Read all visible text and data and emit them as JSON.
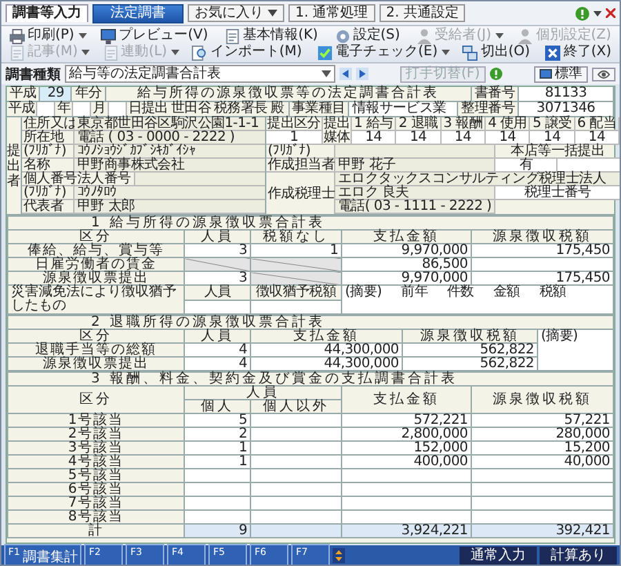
{
  "tabs": [
    {
      "label": "調書等入力",
      "selected": true
    }
  ],
  "mode_button": "法定調書",
  "menus": [
    {
      "label": "お気に入り",
      "dropdown": true
    },
    {
      "label": "1. 通常処理",
      "dropdown": false
    },
    {
      "label": "2. 共通設定",
      "dropdown": false
    }
  ],
  "toolbar": [
    {
      "label": "印刷(P)",
      "disabled": false,
      "dropdown": true
    },
    {
      "label": "プレビュー(V)",
      "disabled": false,
      "dropdown": false
    },
    {
      "label": "基本情報(K)",
      "disabled": false,
      "dropdown": false
    },
    {
      "label": "設定(S)",
      "disabled": false,
      "dropdown": false
    },
    {
      "label": "受給者(J)",
      "disabled": true,
      "dropdown": true
    },
    {
      "label": "個別設定(Z)",
      "disabled": true,
      "dropdown": false
    },
    {
      "label": "記事(M)",
      "disabled": true,
      "dropdown": true
    },
    {
      "label": "連動(L)",
      "disabled": true,
      "dropdown": true
    },
    {
      "label": "インポート(M)",
      "disabled": false,
      "dropdown": false
    },
    {
      "label": "電子チェック(E)",
      "disabled": false,
      "dropdown": true
    },
    {
      "label": "切出(O)",
      "disabled": false,
      "dropdown": false
    },
    {
      "label": "終了(X)",
      "disabled": false,
      "dropdown": false
    }
  ],
  "doc_type": {
    "label": "調書種類",
    "value": "給与等の法定調書合計表"
  },
  "switch_button": {
    "label": "打手切替(F)",
    "disabled": true
  },
  "view_button": "標準",
  "form": {
    "era": "平成",
    "year": "29",
    "year_suffix": "年分",
    "title": "給与所得の源泉徴収票等の法定調書合計表",
    "doc_number_label": "書番号",
    "doc_number": "81133",
    "submission": {
      "era": "平成",
      "units": [
        "年",
        "月",
        "日提出"
      ],
      "office": "世田谷",
      "office_suffix": "税務署長",
      "honorific": "殿"
    },
    "business_label": "事業種目",
    "business": "情報サービス業",
    "ref_label": "整理番号",
    "ref": "3071346",
    "submitter_label": "提出者",
    "left_rows": [
      {
        "labels": [
          "住所又は"
        ],
        "value": "東京都世田谷区駒沢公園1-1-1"
      },
      {
        "labels": [
          "所在地"
        ],
        "value": "電話 ( 03 - 0000 - 2222 )"
      },
      {
        "labels": [
          "(ﾌﾘｶﾞﾅ)"
        ],
        "value": "ｺｳﾉｼｮｳｼﾞｶﾌﾞｼｷｶﾞｲｼｬ"
      },
      {
        "labels": [
          "名称"
        ],
        "value": "甲野商事株式会社"
      },
      {
        "labels": [
          "個人番号",
          "法人番号"
        ]
      },
      {
        "labels": [
          "(ﾌﾘｶﾞﾅ)"
        ],
        "value": "ｺｳﾉﾀﾛｳ"
      },
      {
        "labels": [
          "代表者"
        ],
        "value": "甲野 太郎"
      }
    ],
    "filing": {
      "class_label": "提出区分",
      "class": "1",
      "media_label": "提出媒体",
      "media": [
        {
          "label": "1 給与",
          "value": "14"
        },
        {
          "label": "2 退職",
          "value": "14"
        },
        {
          "label": "3 報酬",
          "value": "14"
        },
        {
          "label": "4 使用",
          "value": "14"
        },
        {
          "label": "5 譲受",
          "value": "14"
        },
        {
          "label": "6 配当",
          "value": "14"
        }
      ]
    },
    "kana_label": "(ﾌﾘｶﾞﾅ)",
    "head_office_label": "本店等一括提出",
    "head_office": "有",
    "contact_label": "作成担当者",
    "contact": "甲野 花子",
    "accountant_label": "作成税理士",
    "accountant_firm": "エロクタックスコンサルティング税理士法人",
    "accountant": "エロク 良夫",
    "accountant_no_label": "税理士番号",
    "accountant_phone": "電話( 03 - 1111 - 2222 )",
    "sec1": {
      "number": "1",
      "title": "給与所得の源泉徴収票合計表",
      "label_column": "区分",
      "columns": [
        "人員",
        "税額なし",
        "支払金額",
        "源泉徴収税額"
      ],
      "rows": [
        {
          "label": "俸給、給与、賞与等",
          "cells": [
            {
              "kind": "value",
              "text": "3"
            },
            {
              "kind": "value",
              "text": "1"
            },
            {
              "kind": "value",
              "text": "9,970,000"
            },
            {
              "kind": "value",
              "text": "175,450"
            }
          ]
        },
        {
          "label": "日雇労働者の賃金",
          "cells": [
            {
              "kind": "na"
            },
            {
              "kind": "na"
            },
            {
              "kind": "value",
              "text": "86,500"
            },
            {
              "kind": "value"
            }
          ]
        },
        {
          "label": "源泉徴収票提出",
          "cells": [
            {
              "kind": "value",
              "text": "3"
            },
            {
              "kind": "na"
            },
            {
              "kind": "value",
              "text": "9,970,000"
            },
            {
              "kind": "value",
              "text": "175,450"
            }
          ]
        }
      ],
      "relief": {
        "label": "災害減免法により徴収猶予したもの",
        "columns": [
          "人員",
          "徴収猶予税額"
        ],
        "notes": [
          "(摘要)",
          "前年",
          "件数",
          "金額",
          "税額"
        ]
      }
    },
    "sec2": {
      "number": "2",
      "title": "退職所得の源泉徴収票合計表",
      "label_column": "区分",
      "columns": [
        "人員",
        "支払金額",
        "源泉徴収税額"
      ],
      "note_label": "(摘要)",
      "rows": [
        {
          "label": "退職手当等の総額",
          "cells": [
            "4",
            "44,300,000",
            "562,822"
          ]
        },
        {
          "label": "源泉徴収票提出",
          "cells": [
            "4",
            "44,300,000",
            "562,822"
          ]
        }
      ]
    },
    "sec3": {
      "number": "3",
      "title": "報酬、料金、契約金及び賞金の支払調書合計表",
      "label_column": "区分",
      "columns": [
        {
          "label": "人員",
          "colspan": 2
        },
        {
          "label": "支払金額"
        },
        {
          "label": "源泉徴収税額"
        }
      ],
      "subcolumns": [
        "個人",
        "個人以外"
      ],
      "rows": [
        {
          "kind": "item",
          "label": "1号該当",
          "cells": [
            "5",
            null,
            "572,221",
            "57,221"
          ]
        },
        {
          "kind": "item",
          "label": "2号該当",
          "cells": [
            "2",
            null,
            "2,800,000",
            "280,000"
          ]
        },
        {
          "kind": "item",
          "label": "3号該当",
          "cells": [
            "1",
            null,
            "152,000",
            "15,200"
          ]
        },
        {
          "kind": "item",
          "label": "4号該当",
          "cells": [
            "1",
            null,
            "400,000",
            "40,000"
          ]
        },
        {
          "kind": "item",
          "label": "5号該当",
          "cells": [
            null,
            null,
            null,
            null
          ]
        },
        {
          "kind": "item",
          "label": "6号該当",
          "cells": [
            null,
            null,
            null,
            null
          ]
        },
        {
          "kind": "item",
          "label": "7号該当",
          "cells": [
            null,
            null,
            null,
            null
          ]
        },
        {
          "kind": "item",
          "label": "8号該当",
          "cells": [
            null,
            null,
            null,
            null
          ]
        },
        {
          "kind": "total",
          "label": "計",
          "cells": [
            "9",
            null,
            "3,924,221",
            "392,421"
          ]
        }
      ]
    }
  },
  "function_keys": [
    {
      "key": "F1",
      "label": "調書集計"
    },
    {
      "key": "F2"
    },
    {
      "key": "F3"
    },
    {
      "key": "F4"
    },
    {
      "key": "F5"
    },
    {
      "key": "F6"
    },
    {
      "key": "F7"
    }
  ],
  "status": [
    "通常入力",
    "計算あり"
  ]
}
